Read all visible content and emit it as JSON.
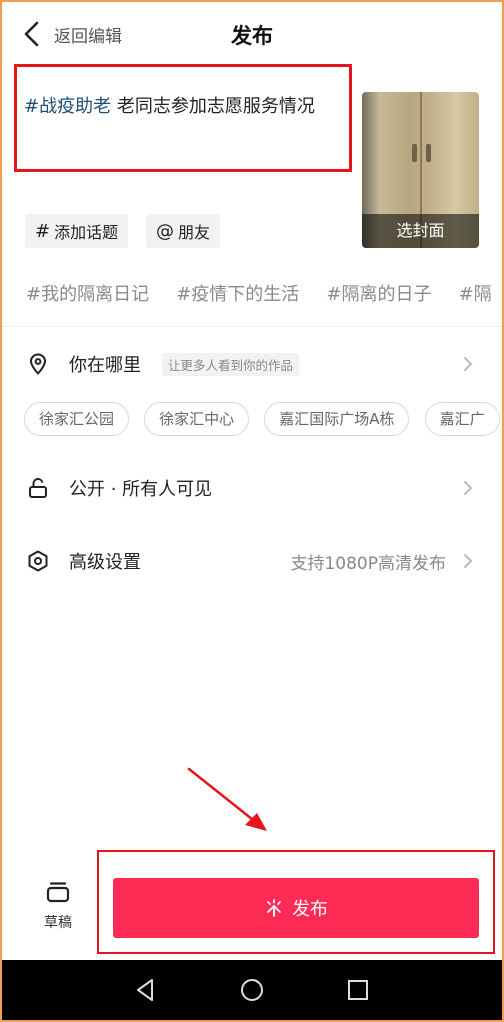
{
  "header": {
    "back_label": "返回编辑",
    "title": "发布"
  },
  "caption": {
    "hashtag": "#战疫助老",
    "text": " 老同志参加志愿服务情况"
  },
  "cover": {
    "label": "选封面"
  },
  "actions": {
    "add_topic_symbol": "#",
    "add_topic": "添加话题",
    "mention_symbol": "@",
    "mention": "朋友"
  },
  "topic_suggestions": [
    "#我的隔离日记",
    "#疫情下的生活",
    "#隔离的日子",
    "#隔"
  ],
  "location": {
    "label": "你在哪里",
    "hint": "让更多人看到你的作品",
    "icon": "location-pin-icon",
    "places": [
      "徐家汇公园",
      "徐家汇中心",
      "嘉汇国际广场A栋",
      "嘉汇广"
    ]
  },
  "privacy": {
    "label": "公开 · 所有人可见",
    "icon": "unlock-icon"
  },
  "advanced": {
    "label": "高级设置",
    "value": "支持1080P高清发布",
    "icon": "hexagon-settings-icon"
  },
  "bottom": {
    "draft_label": "草稿",
    "publish_label": "发布"
  },
  "colors": {
    "accent": "#fe2c55",
    "annotation": "#e8141c",
    "hashtag": "#1f4e79"
  }
}
